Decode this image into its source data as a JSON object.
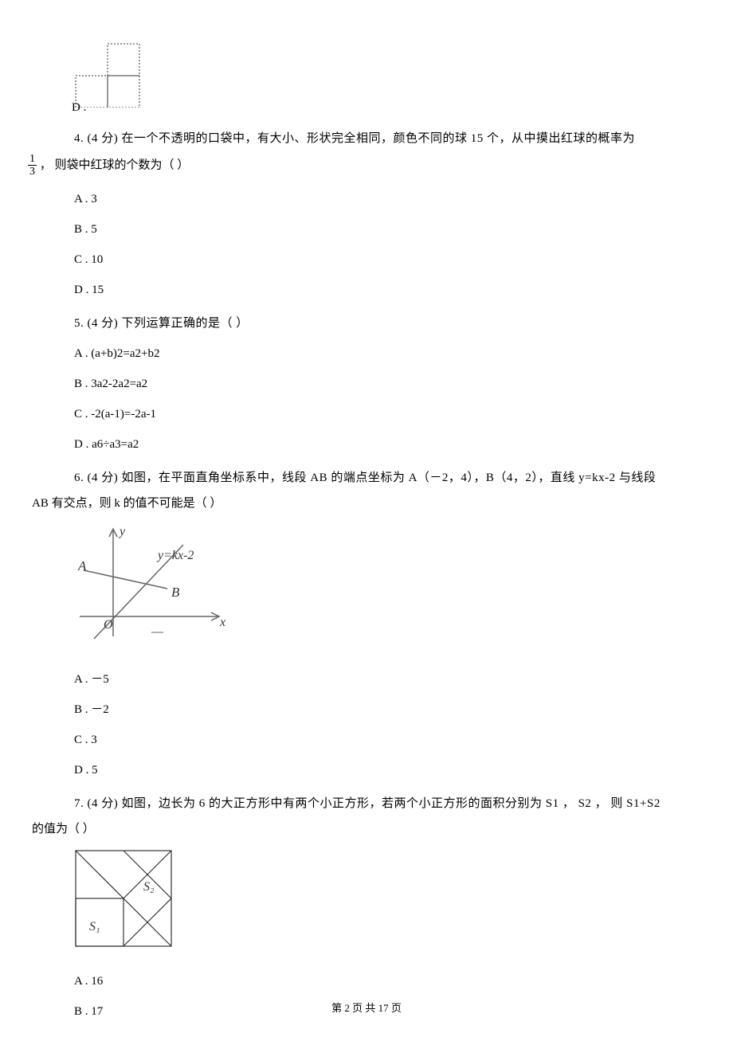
{
  "q3_optD_label": "D .",
  "q4": {
    "line1": "4.  (4 分)   在一个不透明的口袋中，有大小、形状完全相同，颜色不同的球 15 个，从中摸出红球的概率为",
    "frac_num": "1",
    "frac_den": "3",
    "line2_rest": "，  则袋中红球的个数为（   ）",
    "optA": "A .  3",
    "optB": "B .  5",
    "optC": "C .  10",
    "optD": "D .  15"
  },
  "q5": {
    "stem": "5.  (4 分)   下列运算正确的是（   ）",
    "optA": "A .  (a+b)2=a2+b2",
    "optB": "B .  3a2-2a2=a2",
    "optC": "C .  -2(a-1)=-2a-1",
    "optD": "D .  a6÷a3=a2"
  },
  "q6": {
    "line1": "6.  (4 分)   如图，在平面直角坐标系中，线段 AB 的端点坐标为 A（－2，4），B（4，2），直线 y=kx-2 与线段",
    "line2": "AB 有交点，则 k 的值不可能是（   ）",
    "fig_A": "A",
    "fig_B": "B",
    "fig_O": "O",
    "fig_x": "x",
    "fig_y": "y",
    "fig_eq": "y=kx-2",
    "optA": "A .  －5",
    "optB": "B .  －2",
    "optC": "C .  3",
    "optD": "D .  5"
  },
  "q7": {
    "line1": "7.  (4 分)   如图，边长为 6 的大正方形中有两个小正方形，若两个小正方形的面积分别为 S1 ，  S2 ，   则 S1+S2",
    "line2": "的值为（   ）",
    "fig_S1": "S₁",
    "fig_S2": "S₂",
    "optA": "A .  16",
    "optB": "B .  17"
  },
  "footer": "第 2 页 共 17 页"
}
